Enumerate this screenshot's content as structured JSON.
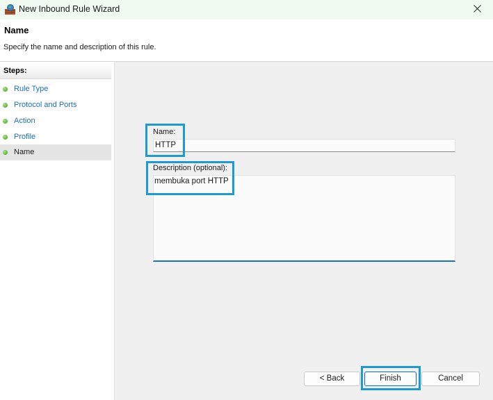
{
  "window": {
    "title": "New Inbound Rule Wizard",
    "close_icon": "close-icon",
    "app_icon": "firewall-app-icon"
  },
  "header": {
    "title": "Name",
    "description": "Specify the name and description of this rule."
  },
  "steps": {
    "heading": "Steps:",
    "items": [
      {
        "label": "Rule Type"
      },
      {
        "label": "Protocol and Ports"
      },
      {
        "label": "Action"
      },
      {
        "label": "Profile"
      },
      {
        "label": "Name"
      }
    ],
    "active_index": 4,
    "bullet_color": "#3c9a1e",
    "link_color": "#1a6fbf"
  },
  "form": {
    "name_label": "Name:",
    "name_value": "HTTP",
    "description_label": "Description (optional):",
    "description_value": "membuka port HTTP"
  },
  "buttons": {
    "back": "< Back",
    "finish": "Finish",
    "cancel": "Cancel"
  },
  "highlight_color": "#1b9ad6"
}
